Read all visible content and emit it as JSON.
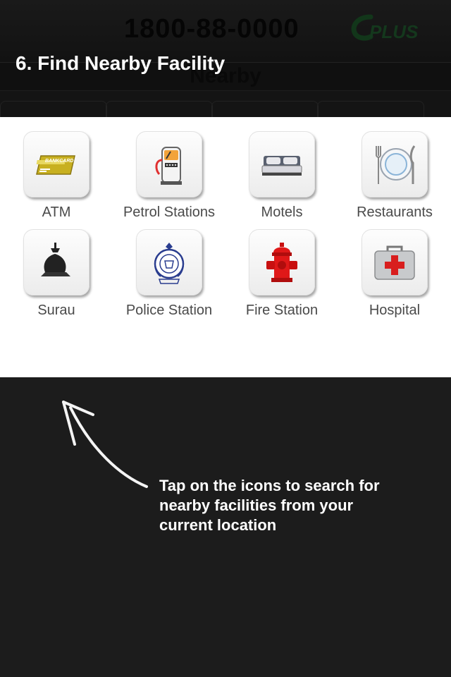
{
  "app_header": {
    "hotline": "1800-88-0000",
    "logo_text": "PLUS",
    "subbar_title": "Nearby"
  },
  "overlay": {
    "step_title": "6. Find Nearby Facility",
    "hint": "Tap on the icons to search for nearby facilities from your current location"
  },
  "facilities": [
    {
      "label": "ATM",
      "icon": "atm-card-icon"
    },
    {
      "label": "Petrol Stations",
      "icon": "fuel-pump-icon"
    },
    {
      "label": "Motels",
      "icon": "bed-icon"
    },
    {
      "label": "Restaurants",
      "icon": "plate-cutlery-icon"
    },
    {
      "label": "Surau",
      "icon": "mosque-dome-icon"
    },
    {
      "label": "Police Station",
      "icon": "police-badge-icon"
    },
    {
      "label": "Fire Station",
      "icon": "fire-hydrant-icon"
    },
    {
      "label": "Hospital",
      "icon": "first-aid-kit-icon"
    }
  ],
  "colors": {
    "overlay_bg": "#1c1c1c",
    "panel_bg": "#ffffff",
    "label_text": "#4a4a4a",
    "logo_green": "#1a4a1c"
  }
}
